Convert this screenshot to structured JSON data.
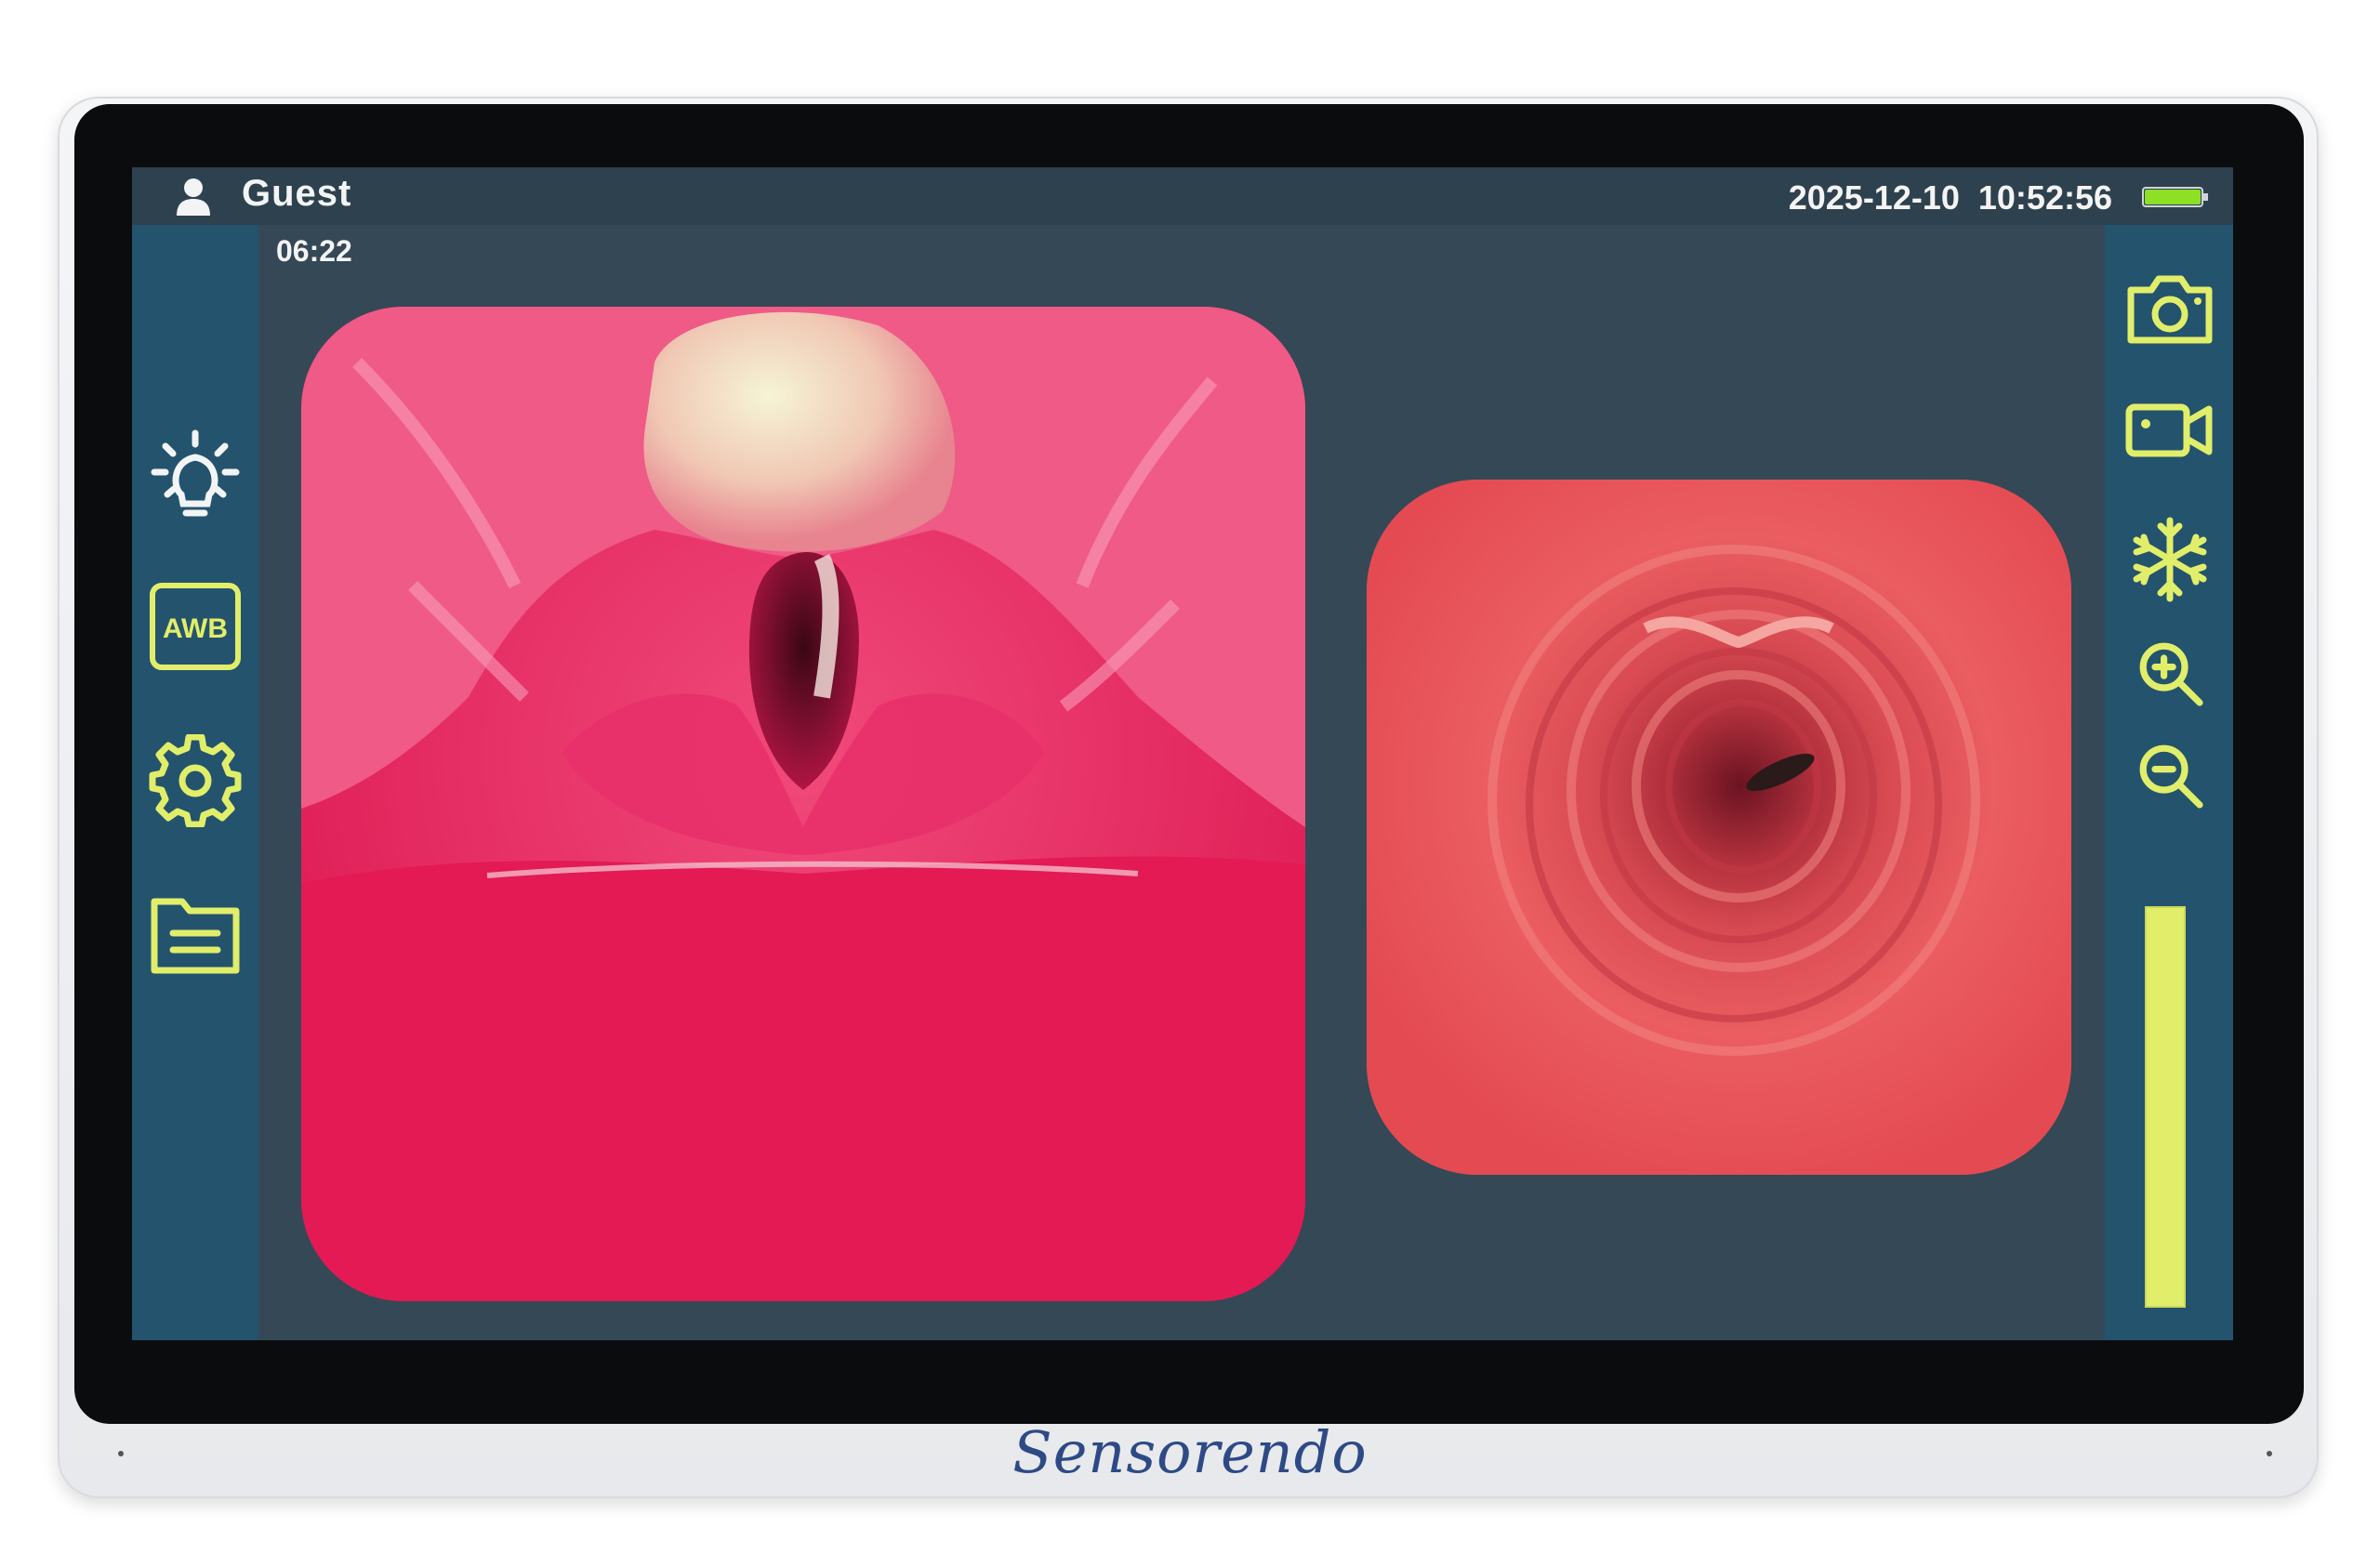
{
  "device": {
    "brand": "Sensorendo"
  },
  "status_bar": {
    "user_icon": "user-icon",
    "user_name": "Guest",
    "datetime": "2025-12-10  10:52:56",
    "battery_icon": "battery-icon",
    "battery_color": "#8de023",
    "recording_timer": "06:22"
  },
  "left_toolbar": {
    "items": [
      {
        "icon": "brightness-icon"
      },
      {
        "icon": "awb-icon",
        "label": "AWB"
      },
      {
        "icon": "gear-icon"
      },
      {
        "icon": "folder-icon"
      }
    ]
  },
  "right_toolbar": {
    "items": [
      {
        "icon": "camera-icon"
      },
      {
        "icon": "video-camera-icon"
      },
      {
        "icon": "snowflake-icon"
      },
      {
        "icon": "zoom-in-icon"
      },
      {
        "icon": "zoom-out-icon"
      }
    ],
    "zoom_level": 1.0
  },
  "colors": {
    "accent_yellow": "#e1ee6a",
    "screen_background": "#354856",
    "toolbar_background": "#24536e"
  },
  "views": {
    "main_feed": "endoscope-laryngeal-view",
    "pip_feed": "endoscope-tracheal-view"
  }
}
